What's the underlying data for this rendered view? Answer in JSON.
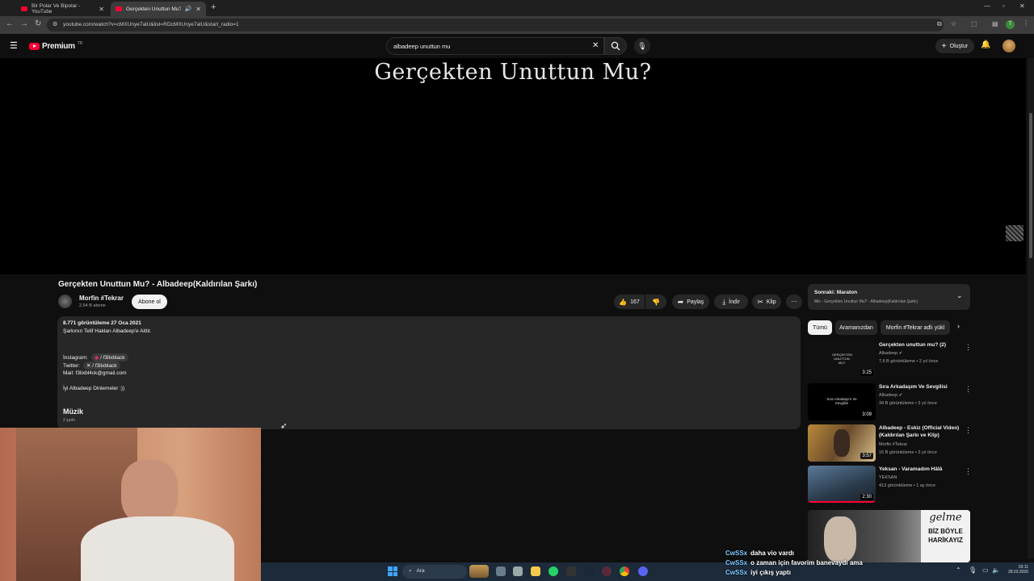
{
  "browser": {
    "tabs": [
      {
        "title": "Bir Polar Ve Bipolar - YouTube"
      },
      {
        "title": "Gerçekten Unuttun Mu? - A"
      }
    ],
    "url": "youtube.com/watch?v=cMXUnye7alU&list=RDcMXUnye7alU&start_radio=1"
  },
  "yt": {
    "logo_text": "Premium",
    "logo_sup": "TR",
    "search_value": "albadeep unuttun mu",
    "create_label": "Oluştur"
  },
  "video": {
    "overlay_title": "Gerçekten Unuttun Mu?",
    "title": "Gerçekten Unuttun Mu? - Albadeep(Kaldırılan Şarkı)",
    "channel": "Morfin #Tekrar",
    "subscribers": "2,54 B abone",
    "subscribe_label": "Abone ol",
    "likes": "167",
    "share_label": "Paylaş",
    "download_label": "İndir",
    "clip_label": "Klip"
  },
  "description": {
    "stats": "8.771 görüntüleme  27 Oca 2021",
    "line1": "Şarkının Telif Hakları Albadeep'e Aittir.",
    "instagram_label": "İnstagram:",
    "instagram_handle": "/ f3lixblack",
    "twitter_label": "Twitter:",
    "twitter_handle": "/ f3lixblack",
    "mail": "Mail: f3lixbl4ck@gmail.com",
    "closing": "İyi Albadeep Dinlemeler :))",
    "music_heading": "Müzik",
    "music_count": "2 şarkı"
  },
  "playlist": {
    "next_label": "Sonraki: Maraton",
    "subtitle": "Mix - Gerçekten Unuttun Mu? - Albadeep(Kaldırılan Şarkı)"
  },
  "chips": [
    "Tümü",
    "Aramanızdan",
    "Morfin #Tekrar adlı yükl"
  ],
  "recommendations": [
    {
      "title": "Gerçekten unuttun mu? (2)",
      "channel": "Albadeep",
      "meta": "7,6 B görüntüleme • 2 yıl önce",
      "duration": "3:25",
      "thumb_text": "GERÇEKTEN UNUTTUN MU?"
    },
    {
      "title": "Sıra Arkadaşım Ve Sevgilisi",
      "channel": "Albadeep",
      "meta": "34 B görüntüleme • 3 yıl önce",
      "duration": "3:09",
      "thumb_text": "Sıra Arkadaşım Ve Sevgilisi"
    },
    {
      "title": "Albadeep - Eskiz (Official Video) (Kaldırılan Şarkı ve Klip)",
      "channel": "Morfin #Tekrar",
      "meta": "16 B görüntüleme • 3 yıl önce",
      "duration": "3:57",
      "thumb_text": ""
    },
    {
      "title": "Yeksan - Varamadım Hâlâ",
      "channel": "YEKSAN",
      "meta": "413 görüntüleme • 1 ay önce",
      "duration": "2:30",
      "thumb_text": ""
    }
  ],
  "promo": {
    "line1": "gelme",
    "line2": "BİZ BÖYLE",
    "line3": "HARİKAYIZ"
  },
  "chat": [
    {
      "user": "CwSSx",
      "text": "daha vio vardı"
    },
    {
      "user": "CwSSx",
      "text": "o zaman için favorim banevaydı ama"
    },
    {
      "user": "CwSSx",
      "text": "iyi çıkış yaptı"
    }
  ],
  "taskbar": {
    "search_label": "Ara",
    "time": "03:11",
    "date": "28.03.2026"
  }
}
